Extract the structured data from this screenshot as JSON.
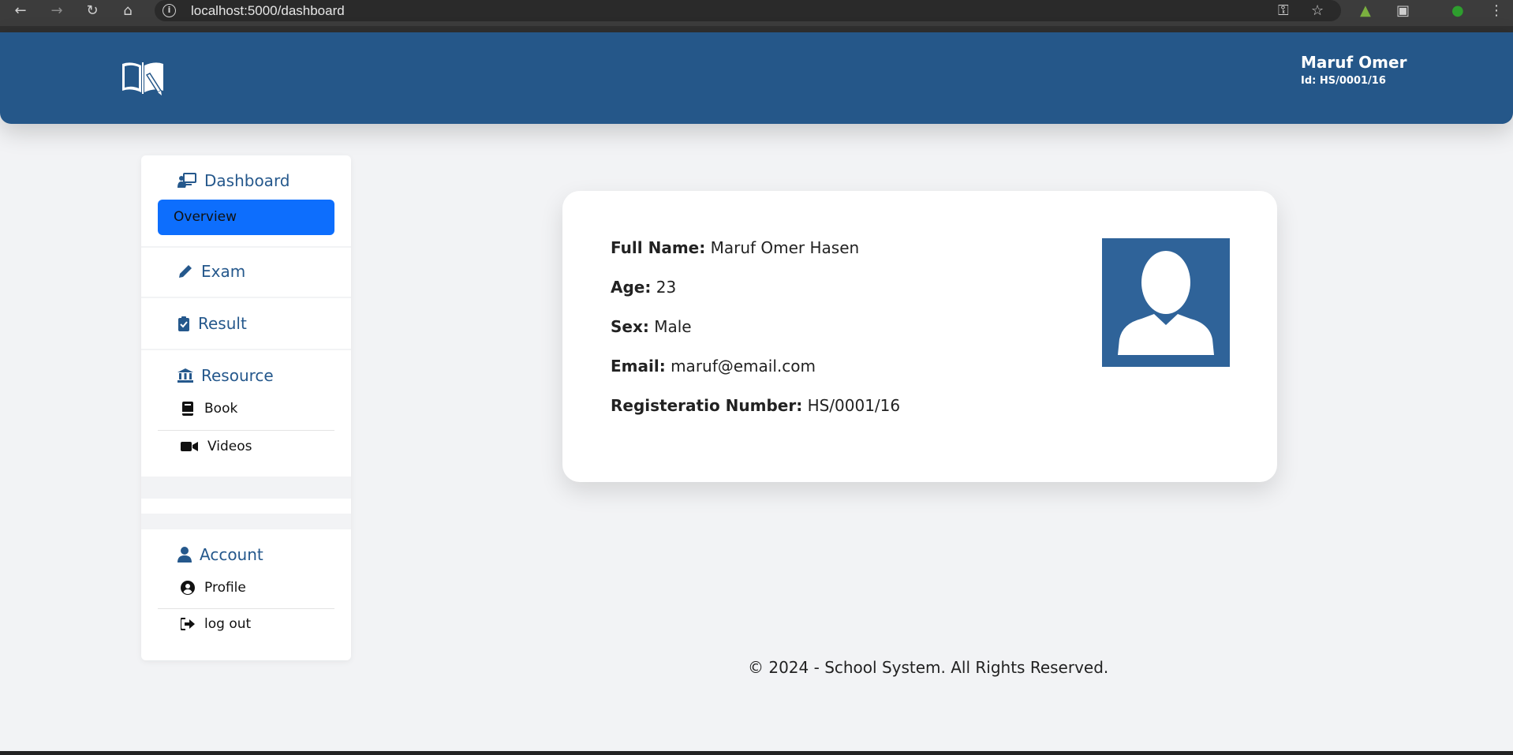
{
  "browser": {
    "url": "localhost:5000/dashboard",
    "icons": [
      "back-icon",
      "forward-icon",
      "reload-icon",
      "home-icon",
      "info-icon",
      "key-icon",
      "star-icon",
      "extension-icon",
      "menu-icon"
    ]
  },
  "header": {
    "user_name": "Maruf Omer",
    "user_id": "Id: HS/0001/16",
    "brand_color": "#255789"
  },
  "sidebar": {
    "dashboard": {
      "label": "Dashboard",
      "items": [
        {
          "label": "Overview",
          "active": true
        }
      ]
    },
    "exam": {
      "label": "Exam"
    },
    "result": {
      "label": "Result"
    },
    "resource": {
      "label": "Resource",
      "items": [
        {
          "label": "Book"
        },
        {
          "label": "Videos"
        }
      ]
    },
    "account": {
      "label": "Account",
      "items": [
        {
          "label": "Profile"
        },
        {
          "label": "log out"
        }
      ]
    },
    "active_color": "#0d6efd"
  },
  "profile": {
    "full_name_label": "Full Name:",
    "full_name": "Maruf Omer Hasen",
    "age_label": "Age:",
    "age": "23",
    "sex_label": "Sex:",
    "sex": "Male",
    "email_label": "Email:",
    "email": "maruf@email.com",
    "reg_label": "Registeratio Number:",
    "reg": "HS/0001/16"
  },
  "footer": {
    "text": "© 2024 - School System. All Rights Reserved."
  }
}
